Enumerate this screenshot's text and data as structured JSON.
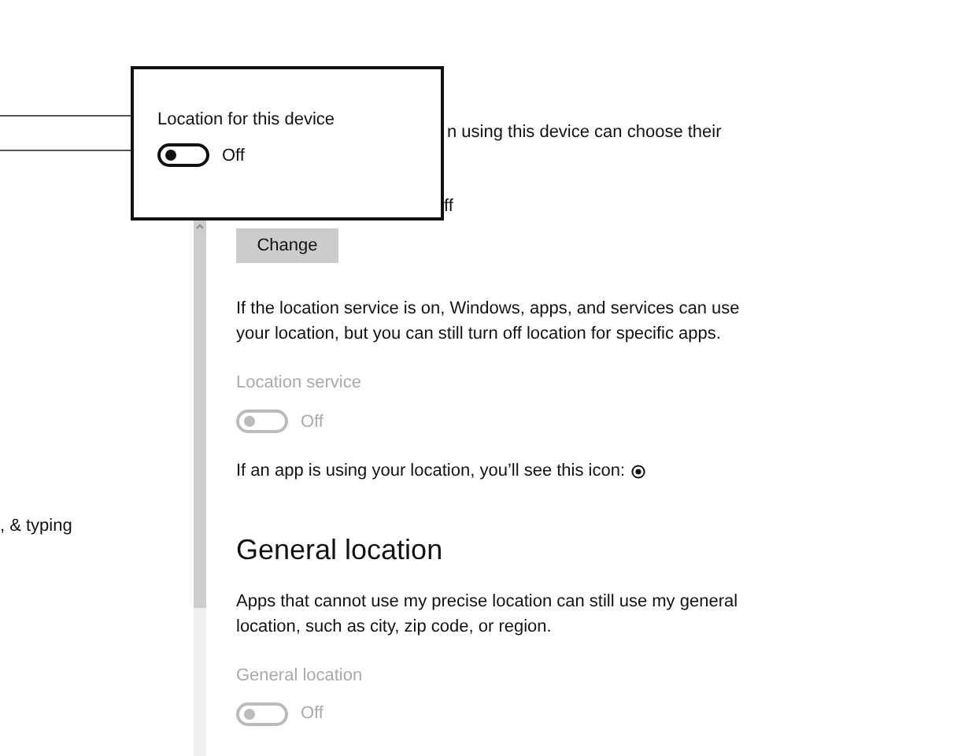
{
  "sidebar": {
    "items": [
      {
        "label": ", & typing"
      }
    ]
  },
  "content": {
    "partial_lines": [
      {
        "text": "n using this device can choose their"
      },
      {
        "text": "ff"
      }
    ],
    "change_button": "Change",
    "service_description": "If the location service is on, Windows, apps, and services can use your location, but you can still turn off location for specific apps.",
    "location_service": {
      "label": "Location service",
      "on": false,
      "state_text": "Off",
      "disabled": true
    },
    "icon_note": "If an app is using your location, you’ll see this icon:",
    "general_heading": "General location",
    "general_description": "Apps that cannot use my precise location can still use my general location, such as city, zip code, or region.",
    "general_location": {
      "label": "General location",
      "on": false,
      "state_text": "Off",
      "disabled": true
    }
  },
  "popup": {
    "label": "Location for this device",
    "toggle": {
      "on": false,
      "state_text": "Off",
      "disabled": false
    }
  }
}
